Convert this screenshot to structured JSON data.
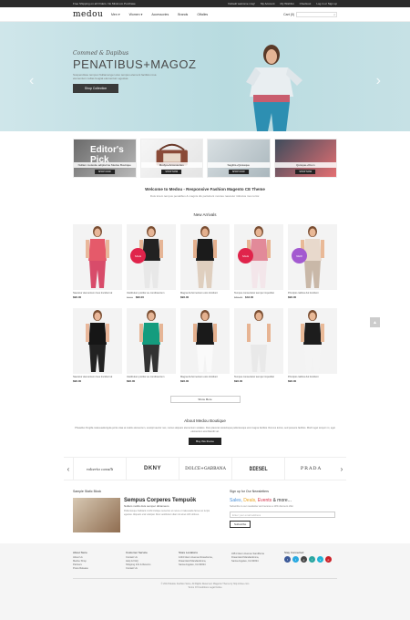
{
  "topbar": {
    "promo": "Free Shipping on all Orders. No Minimum Purchase",
    "links": [
      "Default welcome msg!",
      "My Account",
      "My Wishlist",
      "Checkout",
      "Log in or Sign up"
    ]
  },
  "header": {
    "logo": "medou",
    "nav": [
      "Men",
      "Women",
      "Accessories",
      "Brands",
      "Otfalles"
    ],
    "cart": "Cart (0)",
    "search_icon": "search-icon"
  },
  "hero": {
    "script": "Commed & Dapibus",
    "title": "PENATIBUS+MAGOZ",
    "desc": "Suspendisse tempus Nullamenger elex tempus element facilisis rosa elementum nullas feugiat elementum egestas.",
    "button": "Shop Collection",
    "prev": "‹",
    "next": "›"
  },
  "promos": [
    {
      "label": "Nullam molestie adipiscine Medou Boutique",
      "btn": "SHOP NOW",
      "big": "Editor's Pick"
    },
    {
      "label": "Modyo+Accessories",
      "btn": "SHOP NOW",
      "big": ""
    },
    {
      "label": "Sagittis+Quisaque",
      "btn": "SHOP NOW",
      "big": ""
    },
    {
      "label": "Quisque+Orem",
      "btn": "SHOP NOW",
      "big": ""
    }
  ],
  "welcome": {
    "title": "Welcome to Medou - Responsive Fashion Magento CE Theme",
    "text": "Duis lorem tempus penatibus & magnis dis parturient montes nascetur ridiculus mus tortor."
  },
  "new_arrivals": "New Arrivals",
  "products": [
    {
      "name": "Nascetur elementum risus tincidunt al",
      "price": "$96.00",
      "old": "",
      "badge": "",
      "color": "#e55a6a",
      "skin": "#e9b79a",
      "pants": "#d84c6a"
    },
    {
      "name": "Vestibulum portitor eu condimentum",
      "price": "$96.00",
      "old": "From",
      "badge": "SALE",
      "badge_color": "#e0244b",
      "color": "#222",
      "skin": "#e6b596",
      "pants": "#e8e8e8"
    },
    {
      "name": "Magna da fermentum eros tincidunt",
      "price": "$96.00",
      "old": "",
      "badge": "",
      "color": "#1b1b1b",
      "skin": "#e4b08e",
      "pants": "#dfcfbf"
    },
    {
      "name": "Tempus consectetur semper imperdiet",
      "price": "$43.00",
      "old": "$50.00",
      "badge": "SALE",
      "badge_color": "#e0244b",
      "color": "#e28a99",
      "skin": "#e7b493",
      "pants": "#f3e6ea"
    },
    {
      "name": "Principio catibus dui tincidunt",
      "price": "$96.00",
      "old": "",
      "badge": "NEW",
      "badge_color": "#a35ad0",
      "color": "#e8d9cc",
      "skin": "#e9b997",
      "pants": "#c9b8a8"
    },
    {
      "name": "Nascetur elementum risus tincidunt al",
      "price": "$96.00",
      "old": "",
      "badge": "",
      "color": "#161616",
      "skin": "#e9b79a",
      "pants": "#222"
    },
    {
      "name": "Vestibulum portitor eu condimentum",
      "price": "$96.00",
      "old": "",
      "badge": "",
      "color": "#159c7e",
      "skin": "#e6b596",
      "pants": "#333"
    },
    {
      "name": "Magna da fermentum eros tincidunt",
      "price": "$96.00",
      "old": "",
      "badge": "",
      "color": "#1a1a1a",
      "skin": "#e4b08e",
      "pants": "#fafafa"
    },
    {
      "name": "Tempus consectetur semper imperdiet",
      "price": "$96.00",
      "old": "",
      "badge": "",
      "color": "#f4f4f4",
      "skin": "#e7b493",
      "pants": "#e9e9e9"
    },
    {
      "name": "Principio catibus dui tincidunt",
      "price": "$96.00",
      "old": "",
      "badge": "",
      "color": "#1d1d1d",
      "skin": "#e9b997",
      "pants": "#f4f4f4"
    }
  ],
  "show_more": "Show More",
  "about": {
    "title": "About Medou Boutique",
    "text": "Phasellus fringilla malesuada ligula porta vitae at mattis elementum, suscipit auctor nec, cursus aliquam elementum sodales. Duis placerat scelerisque pellentesque erat magna facilisis rhoncus lectus, sed posuere facilisis. Morbi eget tempor mi, eget elementum erat blandit vel.",
    "button": "Buy this theme"
  },
  "brands": [
    "roberto cavalli",
    "DKNY",
    "DOLCE+GABBANA",
    "DIESEL",
    "PRADA"
  ],
  "static": {
    "title": "Sample Static Block",
    "headline": "Sempus Corperes Tempuŏk",
    "sub": "Nullam mollis duis semper dictamens",
    "text": "Pellentesque habitant morbi tristique senectus et netus et malesuada fames ac turpis egestas. Aliquam erat volutpat. Duis vestibulum diam sit amet nibh ultrices."
  },
  "newsletter": {
    "title": "Sign up for Our Newsletters",
    "headline_1": "Sales,",
    "headline_2": "Deals,",
    "headline_3": "Events",
    "headline_4": "& more...",
    "sub": "Subscribe to our newsletter and receive a 10% discount offer",
    "placeholder": "Enter your email address",
    "button": "Subscribe"
  },
  "footer": {
    "cols": [
      {
        "h": "About Store",
        "items": [
          "About Us",
          "Medou Shop",
          "Partners",
          "Press Release"
        ]
      },
      {
        "h": "Customer Service",
        "items": [
          "Contact Us",
          "Help & FAQ",
          "Shipping Info & Returns",
          "Contact Us"
        ]
      },
      {
        "h": "Store Locations",
        "items": [
          "1234 Glenn Avenue Rosedonna,",
          "Dreamland Mandardonna,",
          "Santa Angeles, CA 90034"
        ]
      },
      {
        "h": "",
        "items": [
          "3451 Glenn Avenue Sandibona",
          "Dreamland Mandardonna,",
          "Santa Angeles, CA 90034"
        ]
      },
      {
        "h": "Stay Connected",
        "items": []
      }
    ],
    "social": [
      {
        "name": "facebook-icon",
        "glyph": "f",
        "color": "#3b5998"
      },
      {
        "name": "twitter-icon",
        "glyph": "t",
        "color": "#29a9e1"
      },
      {
        "name": "google-plus-icon",
        "glyph": "g",
        "color": "#444"
      },
      {
        "name": "rss-icon",
        "glyph": "r",
        "color": "#2aa6a1"
      },
      {
        "name": "vimeo-icon",
        "glyph": "v",
        "color": "#1fb3d6"
      },
      {
        "name": "pinterest-icon",
        "glyph": "p",
        "color": "#cb2027"
      }
    ],
    "copyright": "© 2013 Medou Fashion Store. All Rights Reserved. Magento Theme by http://oriee.com",
    "terms": "Terms Of Conditions    Legal Notice"
  },
  "to_top": "▲"
}
